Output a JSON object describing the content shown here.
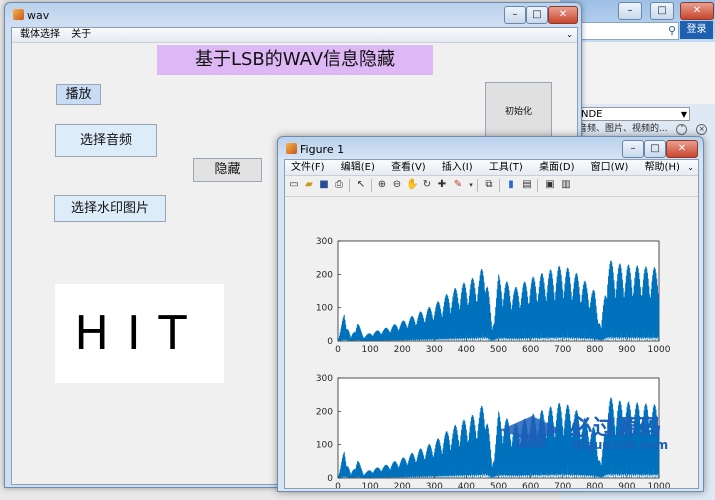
{
  "browser_window": {
    "login_label": "登录",
    "select_value": "NDE",
    "row_text": "音频、图片、视频的...",
    "search_icon": "search-icon"
  },
  "wav_window": {
    "title": "wav",
    "menu": [
      "载体选择",
      "关于"
    ],
    "heading": "基于LSB的WAV信息隐藏",
    "buttons": {
      "play": "播放",
      "select_audio": "选择音频",
      "hide": "隐藏",
      "select_watermark": "选择水印图片",
      "init": "初始化"
    },
    "watermark_image_text": "HIT"
  },
  "figure_window": {
    "title": "Figure 1",
    "menu": [
      "文件(F)",
      "编辑(E)",
      "查看(V)",
      "插入(I)",
      "工具(T)",
      "桌面(D)",
      "窗口(W)",
      "帮助(H)"
    ],
    "toolbar_icons": [
      "new-file-icon",
      "open-icon",
      "save-icon",
      "print-icon",
      "pointer-icon",
      "zoom-in-icon",
      "zoom-out-icon",
      "pan-icon",
      "rotate-icon",
      "data-cursor-icon",
      "brush-icon",
      "link-icon",
      "colorbar-icon",
      "legend-icon",
      "hide-plot-tools-icon",
      "show-plot-tools-icon"
    ]
  },
  "watermark_logo": {
    "text": "必过源码",
    "sub": "Biguo100.com",
    "color": "#1d5fb8"
  },
  "chart_data": [
    {
      "type": "line",
      "x_range": [
        0,
        1000
      ],
      "ylim": [
        0,
        300
      ],
      "xticks": [
        0,
        100,
        200,
        300,
        400,
        500,
        600,
        700,
        800,
        900,
        1000
      ],
      "yticks": [
        0,
        100,
        200,
        300
      ],
      "color": "#0072bd",
      "series": [
        {
          "x": [
            0,
            20,
            40,
            60,
            80,
            100,
            150,
            200,
            250,
            300,
            350,
            400,
            440,
            460,
            480,
            500,
            550,
            600,
            650,
            700,
            750,
            800,
            820,
            840,
            860,
            900,
            950,
            1000
          ],
          "y": [
            0,
            90,
            10,
            60,
            15,
            25,
            40,
            60,
            85,
            110,
            150,
            180,
            200,
            250,
            40,
            200,
            160,
            190,
            210,
            230,
            200,
            150,
            40,
            250,
            235,
            230,
            225,
            220
          ]
        }
      ]
    },
    {
      "type": "line",
      "x_range": [
        0,
        1000
      ],
      "ylim": [
        0,
        300
      ],
      "xticks": [
        0,
        100,
        200,
        300,
        400,
        500,
        600,
        700,
        800,
        900,
        1000
      ],
      "yticks": [
        0,
        100,
        200,
        300
      ],
      "color": "#0072bd",
      "series": [
        {
          "x": [
            0,
            20,
            40,
            60,
            80,
            100,
            150,
            200,
            250,
            300,
            350,
            400,
            440,
            460,
            480,
            500,
            550,
            600,
            650,
            700,
            750,
            800,
            820,
            840,
            860,
            900,
            950,
            1000
          ],
          "y": [
            0,
            90,
            10,
            60,
            15,
            25,
            40,
            60,
            85,
            110,
            150,
            180,
            200,
            250,
            40,
            200,
            160,
            190,
            210,
            230,
            200,
            150,
            40,
            250,
            235,
            230,
            225,
            220
          ]
        }
      ]
    }
  ]
}
